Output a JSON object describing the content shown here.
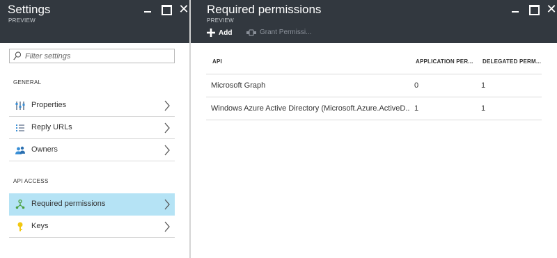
{
  "settings_blade": {
    "title": "Settings",
    "subtitle": "PREVIEW",
    "filter_placeholder": "Filter settings",
    "sections": [
      {
        "header": "GENERAL",
        "items": [
          {
            "label": "Properties",
            "icon": "properties-icon"
          },
          {
            "label": "Reply URLs",
            "icon": "reply-urls-icon"
          },
          {
            "label": "Owners",
            "icon": "owners-icon"
          }
        ]
      },
      {
        "header": "API ACCESS",
        "items": [
          {
            "label": "Required permissions",
            "icon": "permissions-icon",
            "selected": true
          },
          {
            "label": "Keys",
            "icon": "key-icon"
          }
        ]
      }
    ]
  },
  "permissions_blade": {
    "title": "Required permissions",
    "subtitle": "PREVIEW",
    "commands": {
      "add_label": "Add",
      "grant_label": "Grant Permissi..."
    },
    "table": {
      "columns": [
        "API",
        "APPLICATION PER...",
        "DELEGATED PERM..."
      ],
      "rows": [
        {
          "api": "Microsoft Graph",
          "application": "0",
          "delegated": "1"
        },
        {
          "api": "Windows Azure Active Directory (Microsoft.Azure.ActiveD...",
          "application": "1",
          "delegated": "1"
        }
      ]
    }
  },
  "colors": {
    "header_bg": "#32383f",
    "selected_bg": "#b5e3f5",
    "divider": "#d9d9d9"
  }
}
